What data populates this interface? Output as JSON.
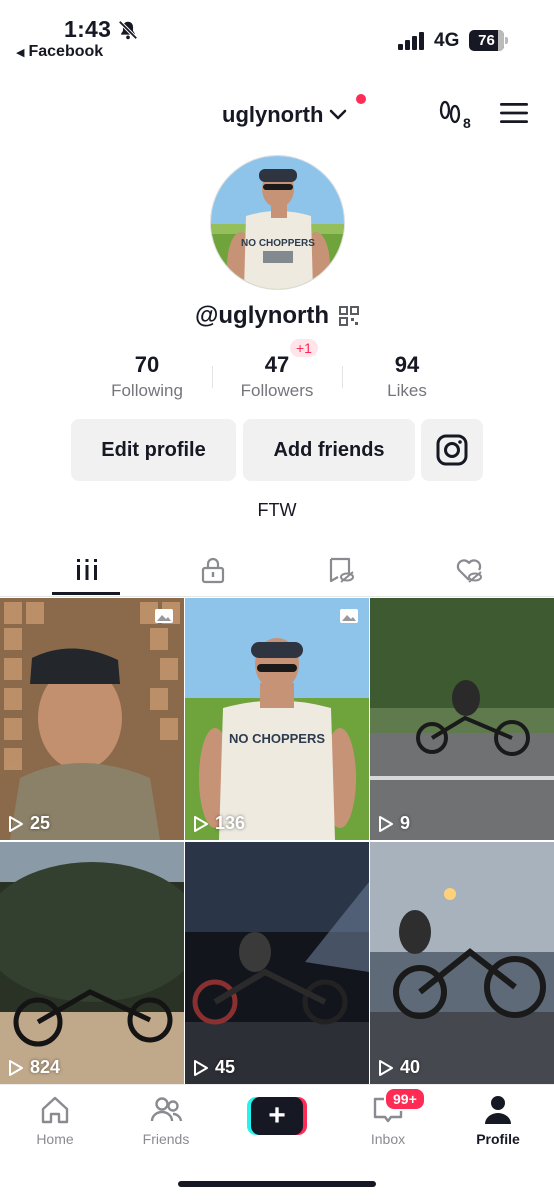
{
  "status_bar": {
    "time": "1:43",
    "back_app": "Facebook",
    "network": "4G",
    "battery": "76"
  },
  "header": {
    "username": "uglynorth",
    "footprint_count": "8"
  },
  "profile": {
    "handle": "@uglynorth",
    "bio": "FTW",
    "stats": [
      {
        "value": "70",
        "label": "Following"
      },
      {
        "value": "47",
        "label": "Followers"
      },
      {
        "value": "94",
        "label": "Likes"
      }
    ],
    "followers_new_badge": "+1"
  },
  "buttons": {
    "edit_profile": "Edit profile",
    "add_friends": "Add friends"
  },
  "videos": [
    {
      "views": "25",
      "photo": true
    },
    {
      "views": "136",
      "photo": true
    },
    {
      "views": "9",
      "photo": false
    },
    {
      "views": "824",
      "photo": false
    },
    {
      "views": "45",
      "photo": false
    },
    {
      "views": "40",
      "photo": false
    }
  ],
  "bottom_nav": {
    "items": [
      {
        "label": "Home",
        "icon": "home-icon"
      },
      {
        "label": "Friends",
        "icon": "friends-icon"
      },
      {
        "label": "",
        "icon": "create-icon"
      },
      {
        "label": "Inbox",
        "icon": "inbox-icon"
      },
      {
        "label": "Profile",
        "icon": "profile-icon"
      }
    ],
    "inbox_badge": "99+"
  }
}
